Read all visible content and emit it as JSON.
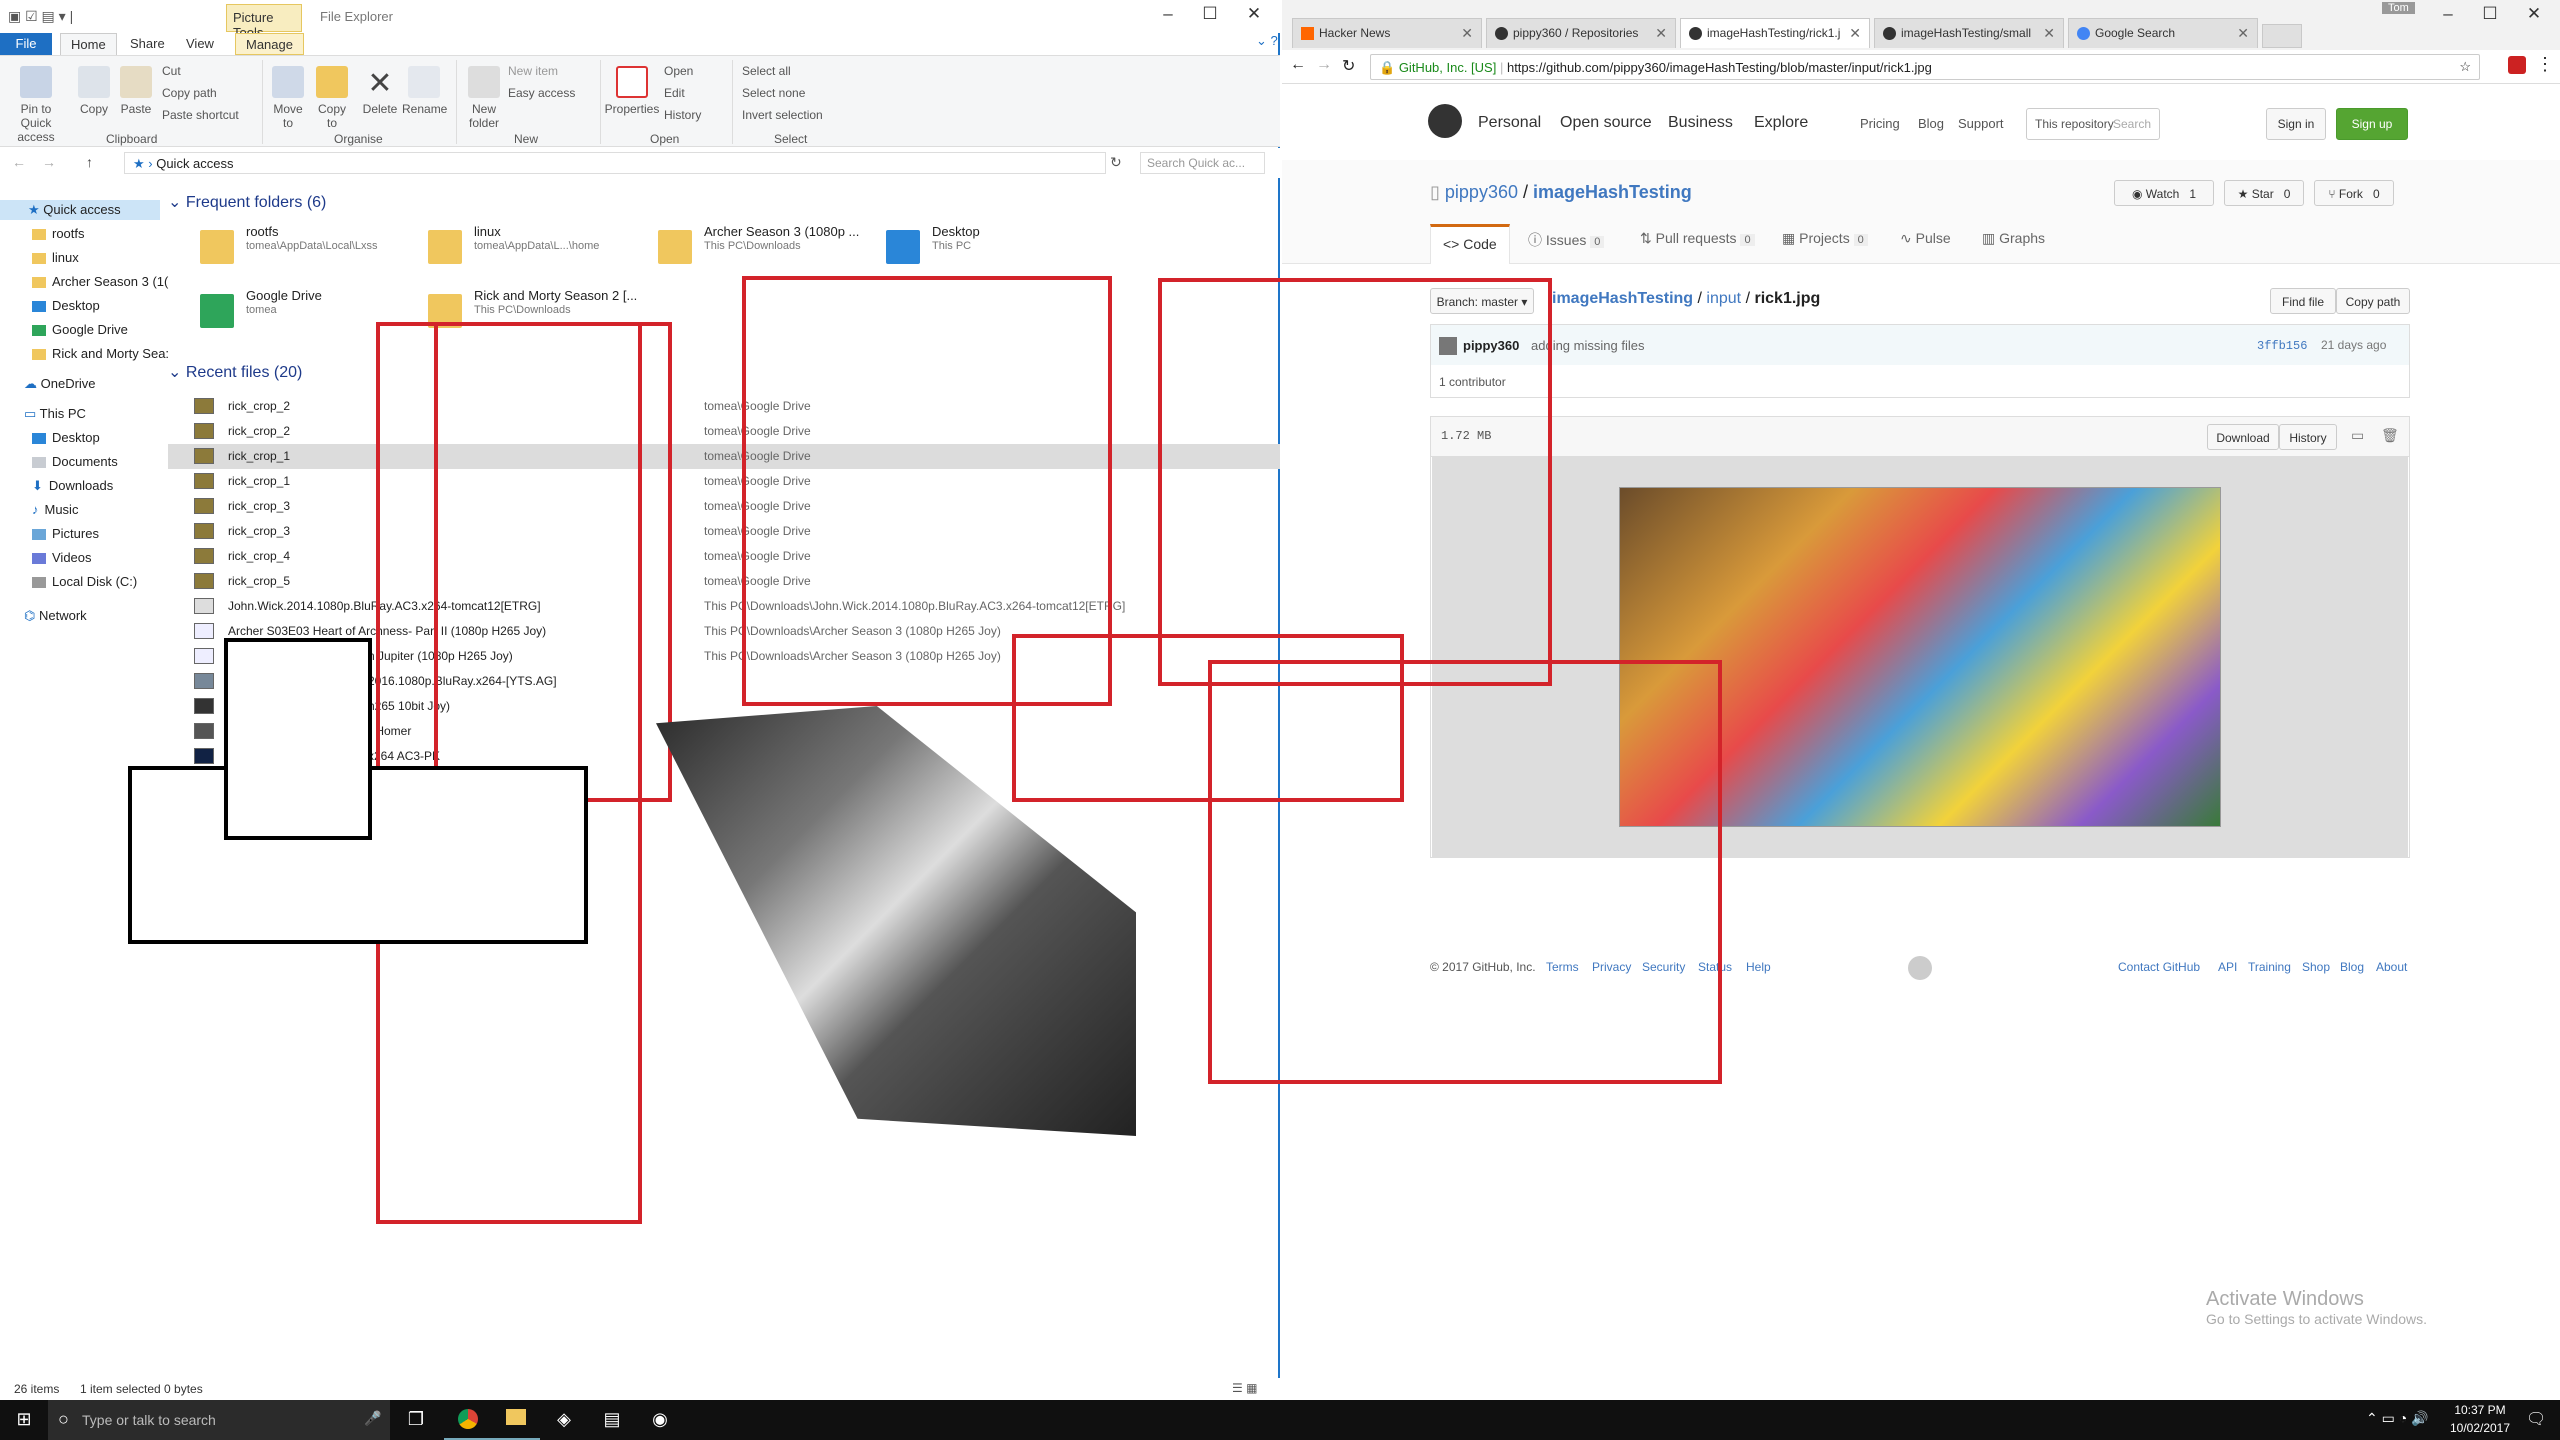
{
  "explorer": {
    "contextual_tab": "Picture Tools",
    "app_title": "File Explorer",
    "tabs": [
      "File",
      "Home",
      "Share",
      "View",
      "Manage"
    ],
    "ribbon": {
      "pin": "Pin to Quick access",
      "copy": "Copy",
      "paste": "Paste",
      "cut": "Cut",
      "copy_path": "Copy path",
      "paste_shortcut": "Paste shortcut",
      "clipboard": "Clipboard",
      "move_to": "Move to",
      "copy_to": "Copy to",
      "delete": "Delete",
      "rename": "Rename",
      "organise": "Organise",
      "new_folder": "New folder",
      "new_item": "New item",
      "easy_access": "Easy access",
      "new": "New",
      "properties": "Properties",
      "open": "Open",
      "edit": "Edit",
      "history": "History",
      "open_group": "Open",
      "select_all": "Select all",
      "select_none": "Select none",
      "invert_selection": "Invert selection",
      "select": "Select"
    },
    "address": "Quick access",
    "search_placeholder": "Search Quick ac...",
    "nav": [
      "Quick access",
      "rootfs",
      "linux",
      "Archer Season 3 (1(",
      "Desktop",
      "Google Drive",
      "Rick and Morty Sea:",
      "OneDrive",
      "This PC",
      "Desktop",
      "Documents",
      "Downloads",
      "Music",
      "Pictures",
      "Videos",
      "Local Disk (C:)",
      "Network"
    ],
    "frequent_header": "Frequent folders (6)",
    "frequent": [
      {
        "name": "rootfs",
        "path": "tomea\\AppData\\Local\\Lxss"
      },
      {
        "name": "linux",
        "path": "tomea\\AppData\\L...\\home"
      },
      {
        "name": "Archer Season 3  (1080p ...",
        "path": "This PC\\Downloads"
      },
      {
        "name": "Desktop",
        "path": "This PC"
      },
      {
        "name": "Google Drive",
        "path": "tomea"
      },
      {
        "name": "Rick and Morty Season 2 [...",
        "path": "This PC\\Downloads"
      }
    ],
    "recent_header": "Recent files (20)",
    "recent": [
      {
        "name": "rick_crop_2",
        "loc": "tomea\\Google Drive"
      },
      {
        "name": "rick_crop_2",
        "loc": "tomea\\Google Drive"
      },
      {
        "name": "rick_crop_1",
        "loc": "tomea\\Google Drive"
      },
      {
        "name": "rick_crop_1",
        "loc": "tomea\\Google Drive"
      },
      {
        "name": "rick_crop_3",
        "loc": "tomea\\Google Drive"
      },
      {
        "name": "rick_crop_3",
        "loc": "tomea\\Google Drive"
      },
      {
        "name": "rick_crop_4",
        "loc": "tomea\\Google Drive"
      },
      {
        "name": "rick_crop_5",
        "loc": "tomea\\Google Drive"
      },
      {
        "name": "John.Wick.2014.1080p.BluRay.AC3.x264-tomcat12[ETRG]",
        "loc": "This PC\\Downloads\\John.Wick.2014.1080p.BluRay.AC3.x264-tomcat12[ETRG]"
      },
      {
        "name": "Archer S03E03 Heart of Archness- Part II (1080p H265 Joy)",
        "loc": "This PC\\Downloads\\Archer Season 3  (1080p H265 Joy)"
      },
      {
        "name": "n Jupiter (1080p H265 Joy)",
        "loc": "This PC\\Downloads\\Archer Season 3  (1080p H265 Joy)"
      },
      {
        "name": "2016.1080p.BluRay.x264-[YTS.AG]",
        "loc": ""
      },
      {
        "name": "h265 10bit Joy)",
        "loc": ""
      },
      {
        "name": "- Homer",
        "loc": ""
      },
      {
        "name": "x264 AC3-PK",
        "loc": ""
      }
    ],
    "status_items": "26 items",
    "status_selected": "1 item selected  0 bytes"
  },
  "chrome": {
    "tabs": [
      "Hacker News",
      "pippy360 / Repositories",
      "imageHashTesting/rick1.j",
      "imageHashTesting/small",
      "Google Search"
    ],
    "secure_label": "GitHub, Inc. [US]",
    "url": "https://github.com/pippy360/imageHashTesting/blob/master/input/rick1.jpg",
    "user_badge": "Tom",
    "gh_nav": [
      "Personal",
      "Open source",
      "Business",
      "Explore"
    ],
    "gh_nav2": [
      "Pricing",
      "Blog",
      "Support"
    ],
    "search_scope": "This repository",
    "search_placeholder": "Search",
    "sign_in": "Sign in",
    "sign_up": "Sign up",
    "owner": "pippy360",
    "repo": "imageHashTesting",
    "watch": "Watch",
    "watch_count": "1",
    "star": "Star",
    "star_count": "0",
    "fork": "Fork",
    "fork_count": "0",
    "repo_tabs": [
      "Code",
      "Issues",
      "0",
      "Pull requests",
      "0",
      "Projects",
      "0",
      "Pulse",
      "Graphs"
    ],
    "branch": "Branch: master",
    "crumb_repo": "imageHashTesting",
    "crumb_dir": "input",
    "crumb_file": "rick1.jpg",
    "find_file": "Find file",
    "copy_path": "Copy path",
    "commit_author": "pippy360",
    "commit_msg": "adding missing files",
    "commit_sha": "3ffb156",
    "commit_time": "21 days ago",
    "contributors": "1 contributor",
    "file_size": "1.72 MB",
    "download": "Download",
    "history": "History",
    "footer_left": [
      "© 2017 GitHub, Inc.",
      "Terms",
      "Privacy",
      "Security",
      "Status",
      "Help"
    ],
    "footer_right": [
      "Contact GitHub",
      "API",
      "Training",
      "Shop",
      "Blog",
      "About"
    ],
    "activate_title": "Activate Windows",
    "activate_sub": "Go to Settings to activate Windows."
  },
  "taskbar": {
    "search_placeholder": "Type or talk to search",
    "time": "10:37 PM",
    "date": "10/02/2017"
  }
}
